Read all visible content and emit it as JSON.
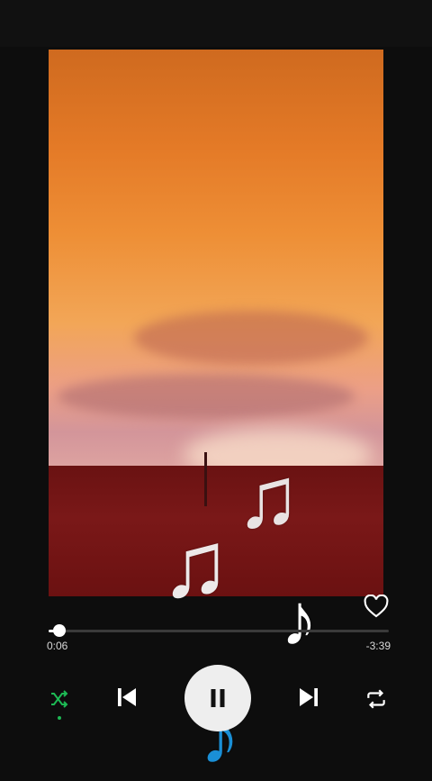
{
  "player": {
    "elapsed": "0:06",
    "remaining": "-3:39",
    "progress_fraction": 0.033,
    "liked": false,
    "shuffle_active": true,
    "accent_color": "#1db954",
    "controls": {
      "shuffle_icon": "shuffle-icon",
      "previous_icon": "skip-previous-icon",
      "play_pause_icon": "pause-icon",
      "next_icon": "skip-next-icon",
      "repeat_icon": "repeat-icon",
      "like_icon": "heart-outline-icon"
    }
  },
  "overlay_notes": [
    "♫",
    "♫",
    "♪",
    "♪"
  ]
}
